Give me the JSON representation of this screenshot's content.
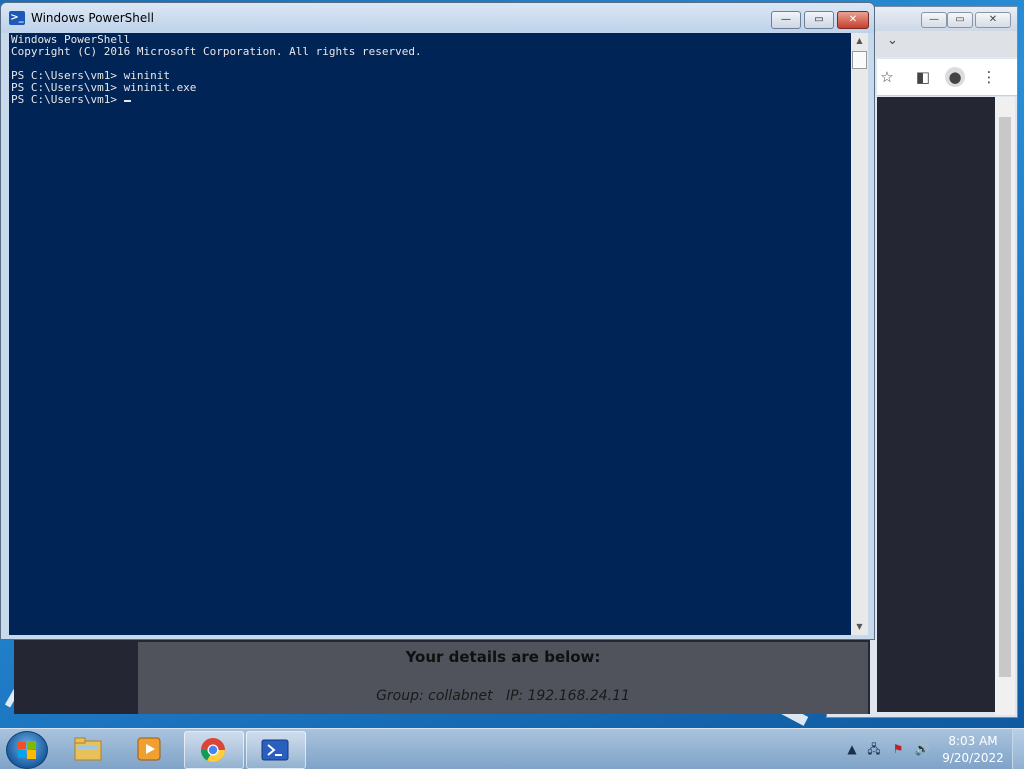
{
  "powershell": {
    "title": "Windows PowerShell",
    "controls": {
      "minimize": "—",
      "maximize": "▭",
      "close": "✕"
    },
    "console_lines": [
      "Windows PowerShell",
      "Copyright (C) 2016 Microsoft Corporation. All rights reserved.",
      "",
      "PS C:\\Users\\vm1> wininit",
      "PS C:\\Users\\vm1> wininit.exe"
    ],
    "prompt": "PS C:\\Users\\vm1> ",
    "colors": {
      "background": "#012456",
      "text": "#e8e8e8"
    }
  },
  "browser": {
    "controls": {
      "minimize": "—",
      "maximize": "▭",
      "close": "✕"
    },
    "tab_dropdown_icon": "chevron-down-icon",
    "toolbar_icons": [
      "star-icon",
      "sidebar-icon",
      "profile-icon",
      "more-icon"
    ]
  },
  "web_page": {
    "heading": "Your details are below:",
    "details": "Group: collabnet   IP: 192.168.24.11"
  },
  "taskbar": {
    "pinned": [
      {
        "name": "start-button",
        "icon": "windows-logo-icon"
      },
      {
        "name": "file-explorer",
        "icon": "folder-icon"
      },
      {
        "name": "media-player",
        "icon": "media-player-icon"
      },
      {
        "name": "chrome",
        "icon": "chrome-icon"
      },
      {
        "name": "powershell",
        "icon": "powershell-icon"
      }
    ],
    "tray": {
      "show_hidden": "▲",
      "icons": [
        "network-icon",
        "action-center-icon",
        "volume-icon"
      ],
      "time": "8:03 AM",
      "date": "9/20/2022"
    }
  }
}
